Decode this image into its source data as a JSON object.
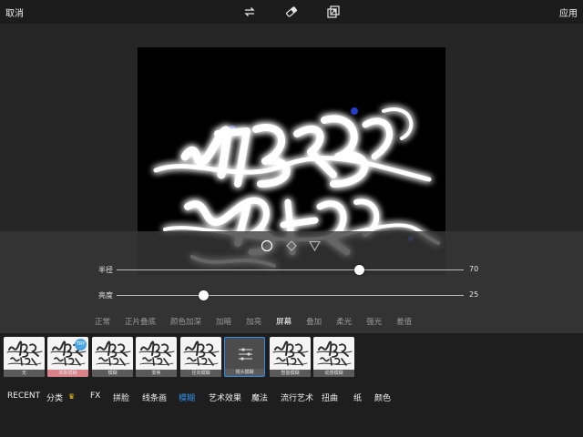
{
  "topbar": {
    "cancel_label": "取消",
    "apply_label": "应用",
    "icons": [
      "swap-icon",
      "eraser-icon",
      "compare-icon"
    ]
  },
  "canvas": {
    "artwork": "glowing calligraphy lettering"
  },
  "shape_selector": {
    "options": [
      "circle-icon",
      "diamond-icon",
      "triangle-icon"
    ],
    "selected": "circle-icon"
  },
  "sliders": {
    "radius": {
      "label": "半径",
      "value": "70",
      "fraction": 0.7
    },
    "brightness": {
      "label": "亮度",
      "value": "25",
      "fraction": 0.25
    }
  },
  "blend_modes": {
    "items": [
      "正常",
      "正片叠底",
      "颜色加深",
      "加暗",
      "加亮",
      "屏幕",
      "叠加",
      "柔光",
      "强光",
      "差值"
    ],
    "active": "屏幕"
  },
  "effects": {
    "items": [
      {
        "label": "无"
      },
      {
        "label": "高斯模糊",
        "badge": "TRY"
      },
      {
        "label": "模糊"
      },
      {
        "label": "变焦"
      },
      {
        "label": "径向模糊"
      },
      {
        "label": "镜头模糊"
      },
      {
        "label": "智能模糊"
      },
      {
        "label": "动感模糊"
      }
    ],
    "selected": "镜头模糊"
  },
  "categories": {
    "items": [
      "RECENT",
      "分类",
      "FX",
      "拼脸",
      "线条画",
      "模糊",
      "艺术效果",
      "魔法",
      "流行艺术",
      "扭曲",
      "纸",
      "颜色"
    ],
    "active": "模糊"
  },
  "colors": {
    "accent": "#2f8fe4",
    "crown": "#f2c21b",
    "try_badge": "#4aa4e6"
  }
}
